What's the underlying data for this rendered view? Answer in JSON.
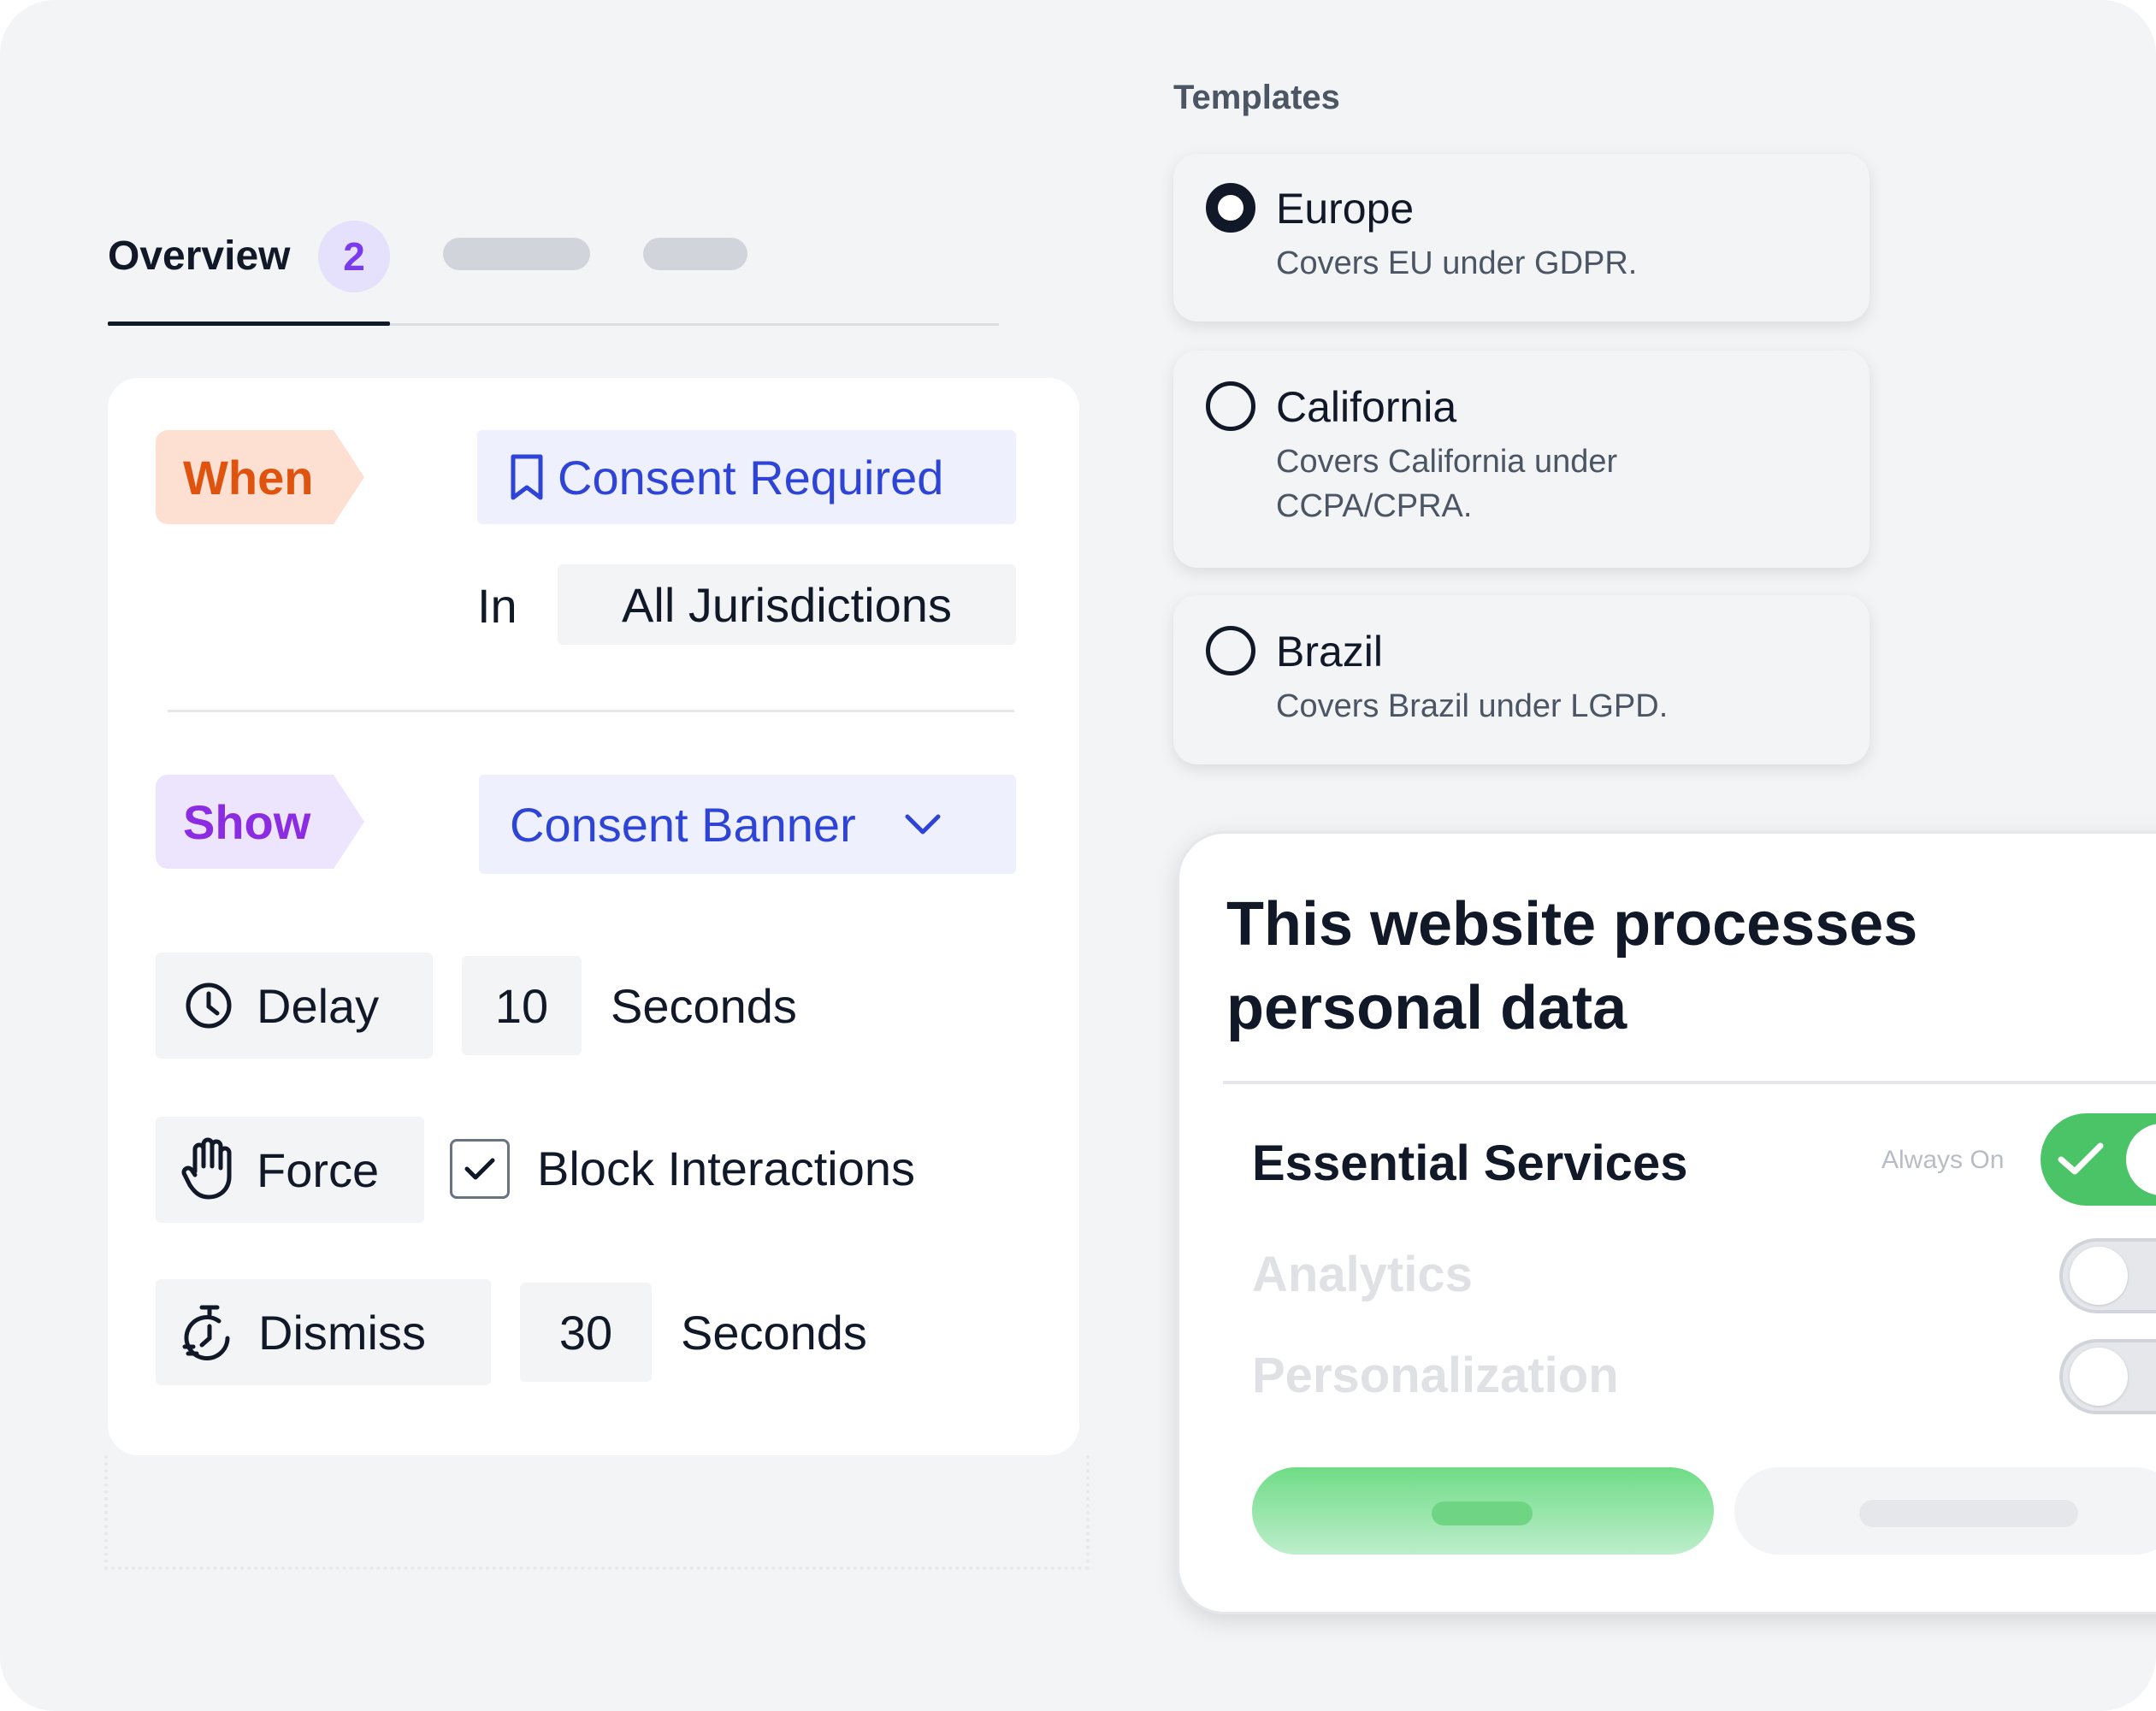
{
  "tabs": {
    "active_label": "Overview",
    "badge_count": "2"
  },
  "rule": {
    "when_tag": "When",
    "trigger": "Consent Required",
    "in_label": "In",
    "jurisdiction": "All Jurisdictions",
    "show_tag": "Show",
    "show_value": "Consent Banner",
    "delay_label": "Delay",
    "delay_value": "10",
    "delay_unit": "Seconds",
    "force_label": "Force",
    "force_option": "Block Interactions",
    "force_checked": true,
    "dismiss_label": "Dismiss",
    "dismiss_value": "30",
    "dismiss_unit": "Seconds"
  },
  "templates": {
    "heading": "Templates",
    "items": [
      {
        "title": "Europe",
        "description": "Covers EU under GDPR.",
        "selected": true
      },
      {
        "title": "California",
        "description": "Covers California under CCPA/CPRA.",
        "selected": false
      },
      {
        "title": "Brazil",
        "description": "Covers Brazil under LGPD.",
        "selected": false
      }
    ]
  },
  "banner": {
    "title": "This website processes personal data",
    "services": [
      {
        "label": "Essential Services",
        "status": "Always On",
        "enabled": true
      },
      {
        "label": "Analytics",
        "enabled": false
      },
      {
        "label": "Personalization",
        "enabled": false
      }
    ]
  },
  "colors": {
    "when_accent": "#e0530f",
    "show_accent": "#8b2be2",
    "link_blue": "#2d44d6",
    "toggle_on": "#4bc467",
    "badge_purple": "#7c3aed"
  }
}
